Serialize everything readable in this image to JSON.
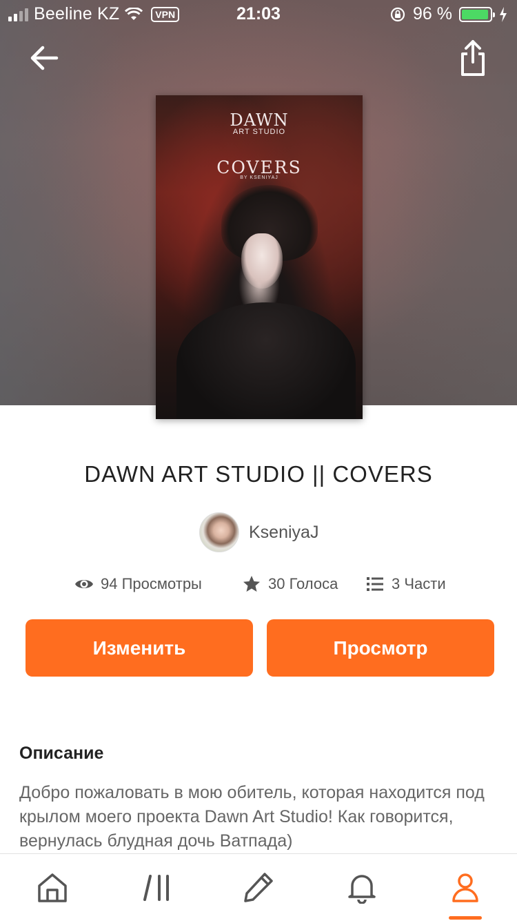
{
  "status_bar": {
    "carrier": "Beeline KZ",
    "vpn": "VPN",
    "time": "21:03",
    "battery": "96 %",
    "battery_level": 0.96,
    "battery_color": "#4cd964"
  },
  "header": {
    "back_icon": "arrow-left-icon",
    "share_icon": "share-icon"
  },
  "cover": {
    "line1": "DAWN",
    "line2": "ART STUDIO",
    "line3": "COVERS",
    "line4": "BY KSENIYAJ"
  },
  "book": {
    "title": "DAWN ART STUDIO || COVERS",
    "author": "KseniyaJ"
  },
  "stats": {
    "views": "94 Просмотры",
    "votes": "30 Голоса",
    "parts": "3 Части"
  },
  "actions": {
    "edit_label": "Изменить",
    "view_label": "Просмотр",
    "accent": "#ff6d1f"
  },
  "description": {
    "heading": "Описание",
    "text": "Добро пожаловать в мою обитель, которая находится под крылом моего проекта Dawn Art Studio! Как говорится, вернулась блудная дочь Ватпада)"
  },
  "tabbar": {
    "items": [
      "home-icon",
      "library-icon",
      "write-icon",
      "notifications-icon",
      "profile-icon"
    ],
    "active": "profile-icon"
  }
}
